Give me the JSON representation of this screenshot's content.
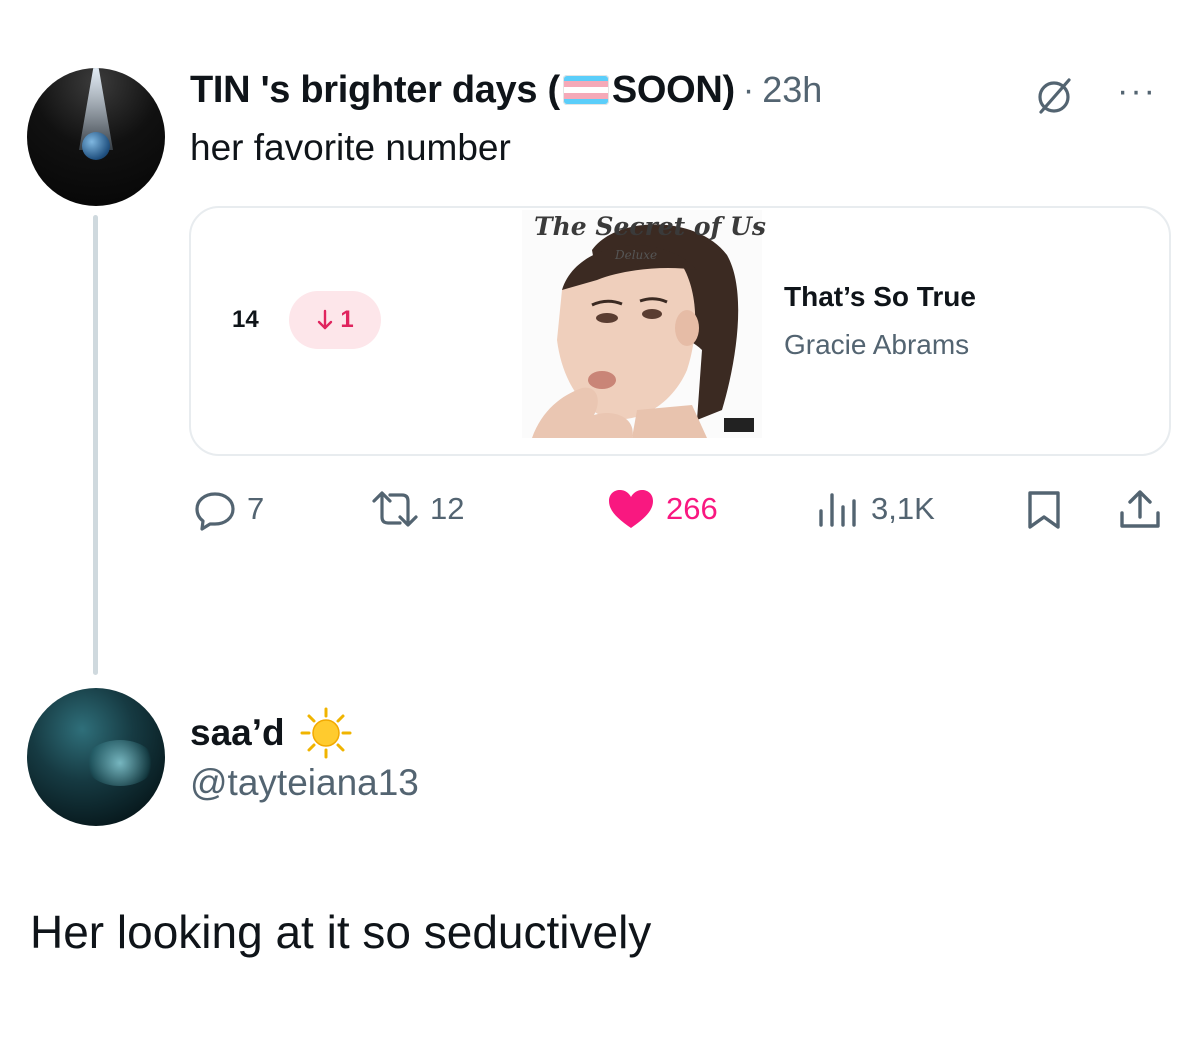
{
  "tweet1": {
    "display_name_part1": "TIN 's brighter days (",
    "display_name_part2": "SOON)",
    "separator": "·",
    "time": "23h",
    "more_label": "···",
    "text": "her favorite number",
    "card": {
      "rank": "14",
      "change": "1",
      "cover_title": "The Secret of Us",
      "cover_subtitle": "Deluxe",
      "song_title": "That’s So True",
      "artist": "Gracie Abrams"
    },
    "actions": {
      "replies": "7",
      "retweets": "12",
      "likes": "266",
      "views": "3,1K"
    }
  },
  "tweet2": {
    "display_name": "saa’d",
    "handle": "@tayteiana13",
    "text": "Her looking at it so seductively"
  },
  "colors": {
    "like": "#f91880",
    "muted": "#536471",
    "thread_line": "#cfd9de",
    "rank_down_bg": "#fde6ea",
    "rank_down_fg": "#e0245e"
  }
}
